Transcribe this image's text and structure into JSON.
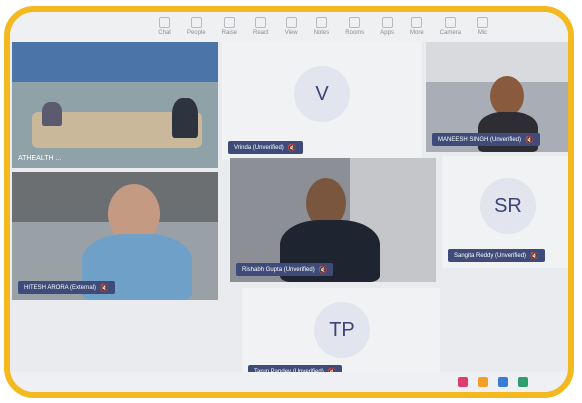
{
  "toolbar": {
    "items": [
      {
        "label": "Chat",
        "icon": "chat-icon"
      },
      {
        "label": "People",
        "icon": "people-icon"
      },
      {
        "label": "Raise",
        "icon": "raise-hand-icon"
      },
      {
        "label": "React",
        "icon": "react-icon"
      },
      {
        "label": "View",
        "icon": "view-icon"
      },
      {
        "label": "Notes",
        "icon": "notes-icon"
      },
      {
        "label": "Rooms",
        "icon": "rooms-icon"
      },
      {
        "label": "Apps",
        "icon": "apps-icon"
      },
      {
        "label": "More",
        "icon": "more-icon"
      },
      {
        "label": "Camera",
        "icon": "camera-icon"
      },
      {
        "label": "Mic",
        "icon": "mic-icon"
      }
    ]
  },
  "tiles": {
    "room": {
      "label": "ATHEALTH",
      "more": "..."
    },
    "vrinda": {
      "initials": "V",
      "name": "Vrinda (Unverified)"
    },
    "maneesh": {
      "name": "MANEESH SINGH (Unverified)"
    },
    "hitesh": {
      "name": "HITESH ARORA (External)"
    },
    "rishabh": {
      "name": "Rishabh Gupta (Unverified)"
    },
    "sangita": {
      "initials": "SR",
      "name": "Sangita Reddy (Unverified)"
    },
    "tarun": {
      "initials": "TP",
      "name": "Tarun Pandey (Unverified)"
    }
  },
  "colors": {
    "frame": "#f4b91f",
    "name_tag": "#3f4c7a",
    "avatar_bg": "#e2e4ee",
    "avatar_text": "#3b4575"
  }
}
